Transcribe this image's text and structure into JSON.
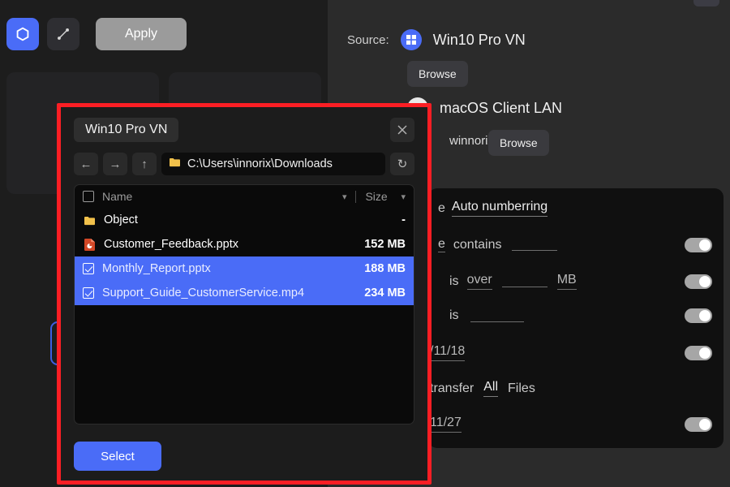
{
  "toolbar": {
    "hexagon_icon": "hexagon-icon",
    "connection_icon": "connection-icon",
    "apply_label": "Apply"
  },
  "source_panel": {
    "source_label": "Source:",
    "source_name": "Win10 Pro VN",
    "browse_label": "Browse",
    "dest_name": "macOS Client LAN",
    "dest_user": "winnorix",
    "dest_browse_label": "Browse"
  },
  "settings": {
    "rows": [
      {
        "name": "Auto numberring",
        "frag1": "e",
        "frag2": "",
        "value": "",
        "unit": "",
        "toggle": true
      },
      {
        "name": "",
        "frag1": "e",
        "frag2": "contains",
        "value": "",
        "unit": "",
        "toggle": true
      },
      {
        "name": "",
        "frag1": "is",
        "frag2": "over",
        "value": "",
        "unit": "MB",
        "toggle": true
      },
      {
        "name": "",
        "frag1": "is",
        "frag2": "",
        "value": "",
        "unit": "",
        "toggle": true
      },
      {
        "name": "",
        "frag1": "/11/18",
        "frag2": "",
        "value": "",
        "unit": "",
        "toggle": true
      },
      {
        "name": "",
        "frag1": "transfer",
        "frag2": "All",
        "value": "Files",
        "unit": "",
        "toggle": false
      },
      {
        "name": "",
        "frag1": "11/27",
        "frag2": "",
        "value": "",
        "unit": "",
        "toggle": true
      }
    ]
  },
  "dialog": {
    "title": "Win10 Pro VN",
    "close_icon": "close-icon",
    "nav": {
      "back_icon": "arrow-left-icon",
      "forward_icon": "arrow-right-icon",
      "up_icon": "arrow-up-icon",
      "refresh_icon": "refresh-icon",
      "folder_icon": "folder-icon",
      "path": "C:\\Users\\innorix\\Downloads"
    },
    "columns": {
      "name": "Name",
      "size": "Size"
    },
    "files": [
      {
        "name": "Object",
        "size": "-",
        "icon": "folder-icon",
        "selected": false,
        "checked": false,
        "type": "folder"
      },
      {
        "name": "Customer_Feedback.pptx",
        "size": "152 MB",
        "icon": "powerpoint-icon",
        "selected": false,
        "checked": false,
        "type": "file"
      },
      {
        "name": "Monthly_Report.pptx",
        "size": "188 MB",
        "icon": "checkbox-icon",
        "selected": true,
        "checked": true,
        "type": "file"
      },
      {
        "name": "Support_Guide_CustomerService.mp4",
        "size": "234 MB",
        "icon": "checkbox-icon",
        "selected": true,
        "checked": true,
        "type": "file"
      }
    ],
    "select_label": "Select"
  },
  "colors": {
    "accent_blue": "#4a6cf7",
    "highlight_red": "#fb1e24",
    "folder_yellow": "#f0c040",
    "pptx_orange": "#d24726"
  }
}
